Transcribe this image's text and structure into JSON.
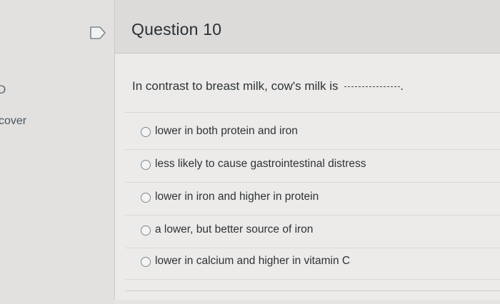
{
  "sidebar": {
    "edge_glyph": "D",
    "edge_text": "cover"
  },
  "question": {
    "title": "Question 10",
    "prompt": "In contrast to breast milk, cow's milk is",
    "blank_end": ".",
    "answers": [
      {
        "label": "lower in both protein and iron"
      },
      {
        "label": "less likely to cause gastrointestinal distress"
      },
      {
        "label": "lower in iron and higher in protein"
      },
      {
        "label": "a lower, but better source of iron"
      },
      {
        "label": "lower in calcium and higher in vitamin C"
      }
    ]
  },
  "icons": {
    "flag": "flag-icon",
    "radio": "radio-button-icon"
  },
  "colors": {
    "background": "#e6e4e3",
    "header": "#dcdbda",
    "text": "#2e3336",
    "radio_border": "#7d8a94"
  }
}
